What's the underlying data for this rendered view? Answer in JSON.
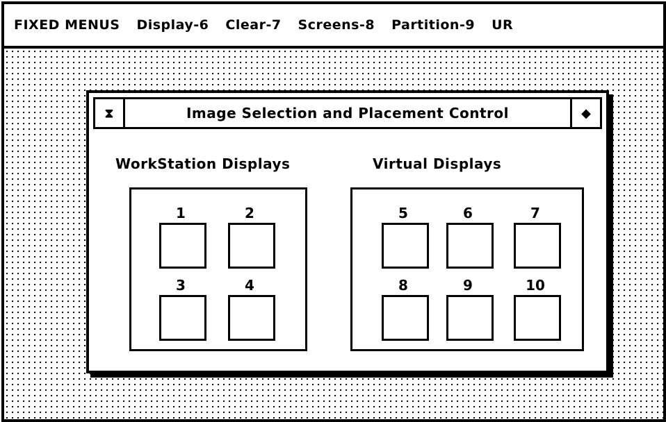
{
  "menubar": {
    "items": [
      "FIXED MENUS",
      "Display-6",
      "Clear-7",
      "Screens-8",
      "Partition-9",
      "UR"
    ]
  },
  "window": {
    "title": "Image Selection and Placement Control",
    "close_glyph": "⧗",
    "zoom_glyph": "◆"
  },
  "workstation": {
    "label": "WorkStation Displays",
    "cells": [
      "1",
      "2",
      "3",
      "4"
    ]
  },
  "virtual": {
    "label": "Virtual Displays",
    "cells": [
      "5",
      "6",
      "7",
      "8",
      "9",
      "10"
    ]
  }
}
